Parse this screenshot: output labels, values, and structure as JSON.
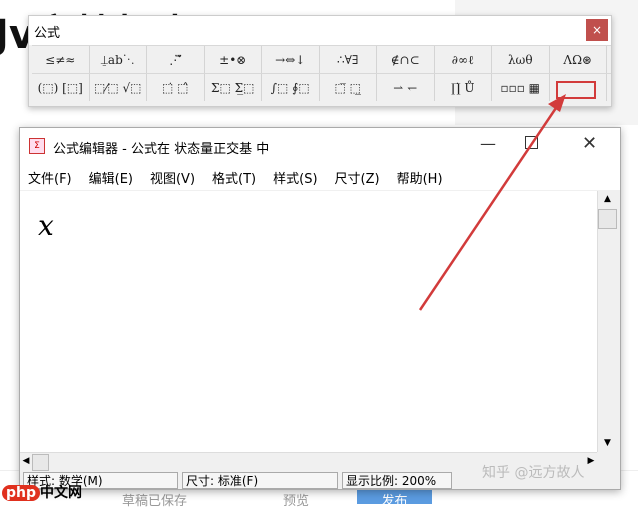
{
  "background": {
    "title": "Jv文档标志",
    "draft_label": "草稿已保存",
    "preview_label": "预览",
    "publish_label": "发布"
  },
  "palette": {
    "title": "公式",
    "close": "×",
    "row1": [
      "≤≠≈",
      "⍊ab⋱",
      "⋰⃗⃛",
      "±•⊗",
      "→⇔↓",
      "∴∀∃",
      "∉∩⊂",
      "∂∞ℓ",
      "λωθ",
      "ΛΩ⊛"
    ],
    "row2": [
      "(⬚) [⬚]",
      "⬚⁄⬚ √⬚",
      "⬚̇ ⬚̂",
      "Σ⬚ Σ̲⬚",
      "∫⬚ ∮⬚",
      "⬚̅ ⬚̲",
      "⇀ ↽",
      "∏̇ Ů",
      "▫▫▫ ▦",
      ""
    ]
  },
  "editor": {
    "title": "公式编辑器 - 公式在 状态量正交基 中",
    "app_icon": "Σ",
    "menu": [
      "文件(F)",
      "编辑(E)",
      "视图(V)",
      "格式(T)",
      "样式(S)",
      "尺寸(Z)",
      "帮助(H)"
    ],
    "content": "x",
    "status": {
      "style": "样式: 数学(M)",
      "size": "尺寸: 标准(F)",
      "zoom": "显示比例: 200%"
    }
  },
  "watermark": "知乎 @远方故人",
  "logo": {
    "p": "php",
    "rest": "中文网"
  },
  "colors": {
    "accent": "#d23b3b",
    "close": "#c0504d",
    "publish": "#5b9be0"
  }
}
